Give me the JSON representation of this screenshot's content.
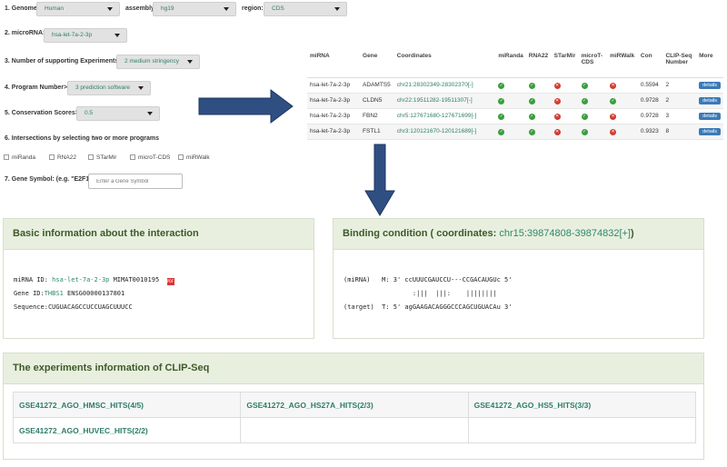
{
  "filters": {
    "genome_label": "1. Genome:",
    "genome_value": "Human",
    "assembly_label": "assembly:",
    "assembly_value": "hg19",
    "region_label": "region:",
    "region_value": "CDS",
    "microrna_label": "2. microRNA:",
    "microrna_value": "hsa-let-7a-2-3p",
    "experiments_label": "3. Number of supporting Experiments>=",
    "experiments_value": "2 medium stringency",
    "program_label": "4. Program Number>=",
    "program_value": "3 prediction software",
    "conservation_label": "5. Conservation Scores>=",
    "conservation_value": "0.5",
    "intersections_label": "6. Intersections by selecting two or more programs",
    "programs": [
      "miRanda",
      "RNA22",
      "STarMir",
      "microT-CDS",
      "miRWalk"
    ],
    "gene_label": "7. Gene Symbol: (e.g. \"E2F1\")",
    "gene_placeholder": "Enter a Gene Symbol"
  },
  "results": {
    "headers": [
      "miRNA",
      "Gene",
      "Coordinates",
      "miRanda",
      "RNA22",
      "STarMir",
      "microT-CDS",
      "miRWalk",
      "Con",
      "CLIP-Seq Number",
      "More"
    ],
    "rows": [
      {
        "mirna": "hsa-let-7a-2-3p",
        "gene": "ADAMTS5",
        "coord": "chr21:28302349-28302370[-]",
        "miranda": "ok",
        "rna22": "ok",
        "starmir": "no",
        "microt": "ok",
        "mirwalk": "no",
        "con": "0.5594",
        "clip": "2",
        "more": "details"
      },
      {
        "mirna": "hsa-let-7a-2-3p",
        "gene": "CLDN5",
        "coord": "chr22:19511282-19511307[-]",
        "miranda": "ok",
        "rna22": "ok",
        "starmir": "no",
        "microt": "ok",
        "mirwalk": "ok",
        "con": "0.9728",
        "clip": "2",
        "more": "details"
      },
      {
        "mirna": "hsa-let-7a-2-3p",
        "gene": "FBN2",
        "coord": "chr5:127671680-127671699[-]",
        "miranda": "ok",
        "rna22": "ok",
        "starmir": "no",
        "microt": "ok",
        "mirwalk": "no",
        "con": "0.9728",
        "clip": "3",
        "more": "details"
      },
      {
        "mirna": "hsa-let-7a-2-3p",
        "gene": "FSTL1",
        "coord": "chr3:120121670-120121689[-]",
        "miranda": "ok",
        "rna22": "ok",
        "starmir": "no",
        "microt": "ok",
        "mirwalk": "no",
        "con": "0.9323",
        "clip": "8",
        "more": "details"
      }
    ]
  },
  "basic": {
    "title": "Basic information about the interaction",
    "mirna_id_label": "miRNA ID: ",
    "mirna_id": "hsa-let-7a-2-3p",
    "mimat": " MIMAT0010195 ",
    "gene_id_label": "Gene ID:",
    "gene_symbol": "THBS1",
    "gene_ens": " ENSG00000137801",
    "sequence_label": "Sequence:",
    "sequence": "CUGUACAGCCUCCUAGCUUUCC"
  },
  "binding": {
    "title_prefix": "Binding condition  ( coordinates: ",
    "coordinates": "chr15:39874808-39874832[+]",
    "title_suffix": ")",
    "line1": "(miRNA)   M: 3' ccUUUCGAUCCU---CCGACAUGUc 5'",
    "line2": "                  :|||  |||:    ||||||||",
    "line3": "(target)  T: 5' agGAAGACAGGGCCCAGCUGUACAu 3'"
  },
  "clip": {
    "title": "The experiments information of CLIP-Seq",
    "cells": [
      "GSE41272_AGO_HMSC_HITS(4/5)",
      "GSE41272_AGO_HS27A_HITS(2/3)",
      "GSE41272_AGO_HS5_HITS(3/3)",
      "GSE41272_AGO_HUVEC_HITS(2/2)",
      "",
      ""
    ]
  },
  "colors": {
    "accent_green": "#2e8a6a",
    "panel_header": "#e9efdf",
    "arrow_blue": "#2f4f82",
    "details_blue": "#3b7ab8"
  }
}
